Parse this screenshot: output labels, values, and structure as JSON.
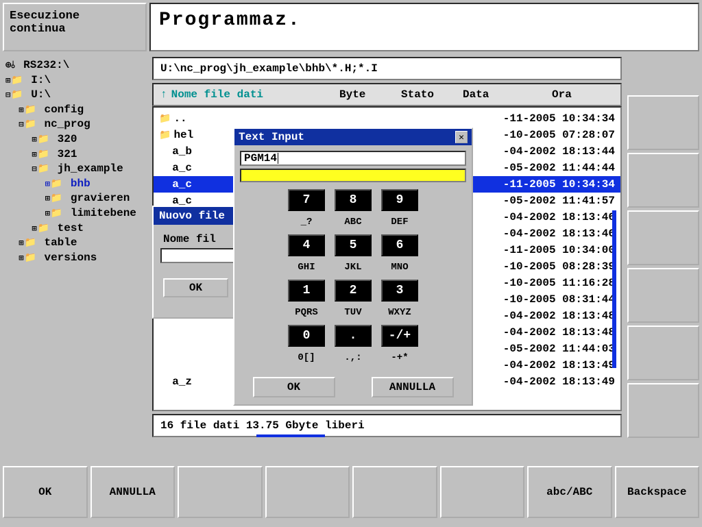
{
  "top": {
    "mode": "Esecuzione\ncontinua",
    "title": "Programmaz."
  },
  "tree": [
    {
      "indent": 0,
      "ico": "rs",
      "exp": "",
      "label": "RS232:\\"
    },
    {
      "indent": 0,
      "ico": "fold",
      "exp": "plus",
      "label": "I:\\"
    },
    {
      "indent": 0,
      "ico": "fold",
      "exp": "minus",
      "label": "U:\\"
    },
    {
      "indent": 1,
      "ico": "fold",
      "exp": "plus",
      "label": "config"
    },
    {
      "indent": 1,
      "ico": "fold",
      "exp": "minus",
      "label": "nc_prog"
    },
    {
      "indent": 2,
      "ico": "fold",
      "exp": "plus",
      "label": "320"
    },
    {
      "indent": 2,
      "ico": "fold",
      "exp": "plus",
      "label": "321"
    },
    {
      "indent": 2,
      "ico": "fold",
      "exp": "minus",
      "label": "jh_example"
    },
    {
      "indent": 3,
      "ico": "fold",
      "exp": "plus",
      "label": "bhb",
      "sel": true
    },
    {
      "indent": 3,
      "ico": "fold",
      "exp": "plus",
      "label": "gravieren"
    },
    {
      "indent": 3,
      "ico": "fold",
      "exp": "plus",
      "label": "limitebene"
    },
    {
      "indent": 2,
      "ico": "fold",
      "exp": "plus",
      "label": "test"
    },
    {
      "indent": 1,
      "ico": "fold",
      "exp": "plus",
      "label": "table"
    },
    {
      "indent": 1,
      "ico": "fold",
      "exp": "plus",
      "label": "versions"
    }
  ],
  "path": "U:\\nc_prog\\jh_example\\bhb\\*.H;*.I",
  "columns": {
    "name": "Nome file dati",
    "byte": "Byte",
    "stato": "Stato",
    "data": "Data",
    "ora": "Ora"
  },
  "files": [
    {
      "ico": "fold",
      "name": "..",
      "rest": "-11-2005 10:34:34"
    },
    {
      "ico": "fold",
      "name": "hel",
      "rest": "-10-2005 07:28:07"
    },
    {
      "ico": "",
      "name": "a_b",
      "rest": "-04-2002 18:13:44"
    },
    {
      "ico": "",
      "name": "a_c",
      "rest": "-05-2002 11:44:44"
    },
    {
      "ico": "",
      "name": "a_c",
      "rest": "-11-2005 10:34:34",
      "sel": true
    },
    {
      "ico": "",
      "name": "a_c",
      "rest": "-05-2002 11:41:57"
    },
    {
      "ico": "",
      "name": "",
      "rest": "-04-2002 18:13:46"
    },
    {
      "ico": "",
      "name": "",
      "rest": "-04-2002 18:13:46"
    },
    {
      "ico": "",
      "name": "",
      "rest": "-11-2005 10:34:00"
    },
    {
      "ico": "",
      "name": "",
      "rest": "-10-2005 08:28:39"
    },
    {
      "ico": "",
      "name": "",
      "rest": "-10-2005 11:16:28"
    },
    {
      "ico": "",
      "name": "",
      "rest": "-10-2005 08:31:44"
    },
    {
      "ico": "",
      "name": "",
      "rest": "-04-2002 18:13:48"
    },
    {
      "ico": "",
      "name": "",
      "rest": "-04-2002 18:13:48"
    },
    {
      "ico": "",
      "name": "",
      "rest": "-05-2002 11:44:03"
    },
    {
      "ico": "",
      "name": "",
      "rest": "-04-2002 18:13:49"
    },
    {
      "ico": "",
      "name": "a_z",
      "rest": "-04-2002 18:13:49"
    }
  ],
  "status": "16  file dati  13.75 Gbyte liberi",
  "dlg_nuovo": {
    "title": "Nuovo file",
    "label": "Nome fil",
    "ok": "OK"
  },
  "dlg_text": {
    "title": "Text Input",
    "value": "PGM14",
    "keys": [
      [
        "7",
        "8",
        "9"
      ],
      [
        "_?",
        "ABC",
        "DEF"
      ],
      [
        "4",
        "5",
        "6"
      ],
      [
        "GHI",
        "JKL",
        "MNO"
      ],
      [
        "1",
        "2",
        "3"
      ],
      [
        "PQRS",
        "TUV",
        "WXYZ"
      ],
      [
        "0",
        ".",
        "-/+"
      ],
      [
        "0[]",
        ".,:",
        "-+*"
      ]
    ],
    "ok": "OK",
    "cancel": "ANNULLA"
  },
  "softkeys_bottom": [
    "OK",
    "ANNULLA",
    "",
    "",
    "",
    "",
    "abc/ABC",
    "Backspace"
  ]
}
